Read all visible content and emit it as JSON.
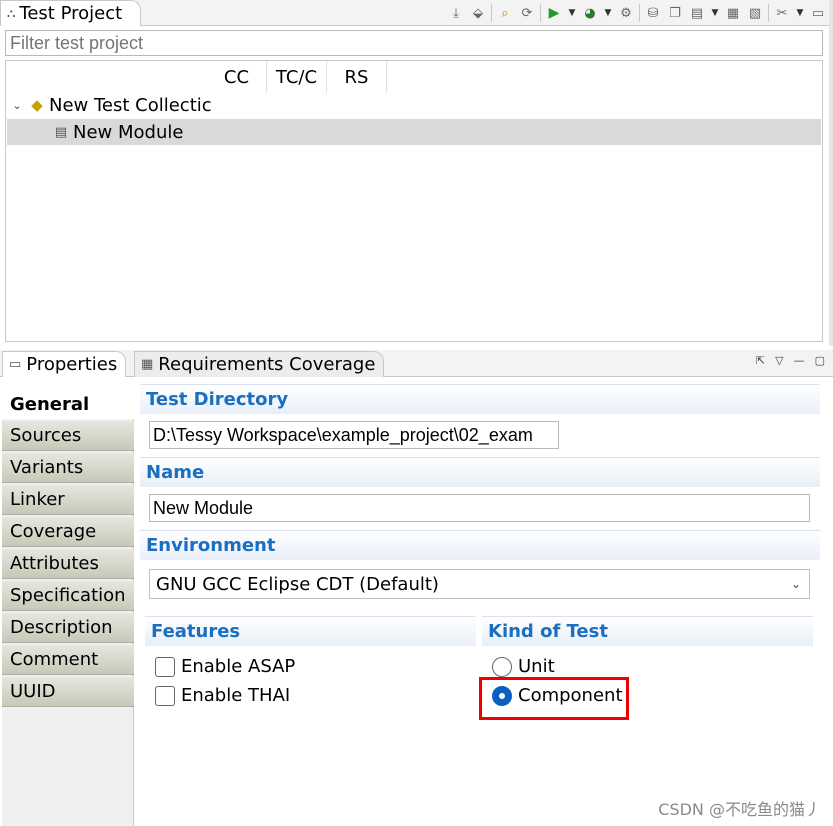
{
  "test_project": {
    "tab_title": "Test Project",
    "filter_placeholder": "Filter test project",
    "columns": [
      "CC",
      "TC/C",
      "RS"
    ],
    "tree": [
      {
        "label": "New Test Collectic",
        "expanded": true,
        "icon": "collection-icon"
      },
      {
        "label": "New Module",
        "selected": true,
        "icon": "module-icon"
      }
    ]
  },
  "properties": {
    "tabs": [
      {
        "label": "Properties",
        "active": true
      },
      {
        "label": "Requirements Coverage",
        "active": false
      }
    ],
    "sidebar": [
      "General",
      "Sources",
      "Variants",
      "Linker",
      "Coverage",
      "Attributes",
      "Specification",
      "Description",
      "Comment",
      "UUID"
    ],
    "active_section": "General",
    "test_directory": {
      "heading": "Test Directory",
      "value": "D:\\Tessy Workspace\\example_project\\02_exam"
    },
    "name": {
      "heading": "Name",
      "value": "New Module"
    },
    "environment": {
      "heading": "Environment",
      "value": "GNU GCC Eclipse CDT (Default)"
    },
    "features": {
      "heading": "Features",
      "options": [
        {
          "label": "Enable ASAP",
          "checked": false
        },
        {
          "label": "Enable THAI",
          "checked": false
        }
      ]
    },
    "kind_of_test": {
      "heading": "Kind of Test",
      "options": [
        {
          "label": "Unit",
          "selected": false
        },
        {
          "label": "Component",
          "selected": true
        }
      ]
    }
  },
  "watermark": "CSDN @不吃鱼的猫丿",
  "colors": {
    "section_heading": "#1a6fbf",
    "highlight": "#f00000",
    "radio_selected": "#0a5fc2"
  }
}
